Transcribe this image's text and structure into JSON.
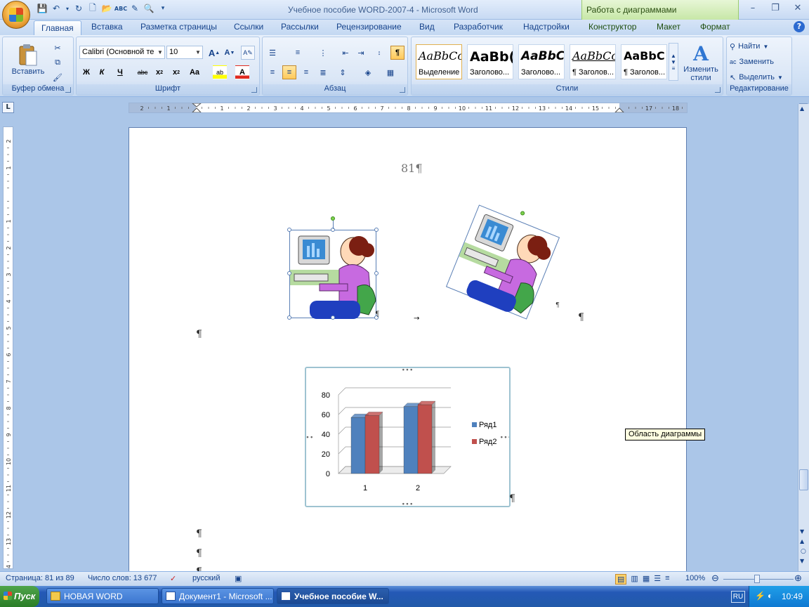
{
  "window": {
    "title": "Учебное пособие WORD-2007-4 - Microsoft Word",
    "contextual_group": "Работа с диаграммами",
    "minimize": "–",
    "maximize": "❐",
    "close": "✕"
  },
  "tabs": [
    {
      "label": "Главная",
      "active": true
    },
    {
      "label": "Вставка"
    },
    {
      "label": "Разметка страницы"
    },
    {
      "label": "Ссылки"
    },
    {
      "label": "Рассылки"
    },
    {
      "label": "Рецензирование"
    },
    {
      "label": "Вид"
    },
    {
      "label": "Разработчик"
    },
    {
      "label": "Надстройки"
    },
    {
      "label": "Конструктор"
    },
    {
      "label": "Макет"
    },
    {
      "label": "Формат"
    }
  ],
  "ribbon": {
    "clipboard": {
      "label": "Буфер обмена",
      "paste": "Вставить"
    },
    "font": {
      "label": "Шрифт",
      "font_name": "Calibri (Основной те",
      "font_size": "10"
    },
    "paragraph": {
      "label": "Абзац"
    },
    "styles": {
      "label": "Стили",
      "items": [
        {
          "sample": "AaBbCc",
          "name": "Выделение"
        },
        {
          "sample": "AaBb(",
          "name": "Заголово..."
        },
        {
          "sample": "AaBbC",
          "name": "Заголово..."
        },
        {
          "sample": "AaBbCc",
          "name": "¶ Заголов..."
        },
        {
          "sample": "AaBbC",
          "name": "¶ Заголов..."
        }
      ],
      "change_styles": "Изменить стили"
    },
    "editing": {
      "label": "Редактирование",
      "find": "Найти",
      "replace": "Заменить",
      "select": "Выделить"
    }
  },
  "ruler_numbers": [
    "2",
    "1",
    "",
    "1",
    "2",
    "3",
    "4",
    "5",
    "6",
    "7",
    "8",
    "9",
    "10",
    "11",
    "12",
    "13",
    "14",
    "15",
    "",
    "17",
    "18"
  ],
  "vruler_numbers": [
    "2",
    "1",
    "",
    "1",
    "2",
    "3",
    "4",
    "5",
    "6",
    "7",
    "8",
    "9",
    "10",
    "11",
    "12",
    "13",
    "14"
  ],
  "document": {
    "page_number": "81¶",
    "pilcrow": "¶"
  },
  "chart_data": {
    "type": "bar",
    "categories": [
      "1",
      "2"
    ],
    "series": [
      {
        "name": "Ряд1",
        "values": [
          57,
          68
        ],
        "color": "#4f81bd"
      },
      {
        "name": "Ряд2",
        "values": [
          59,
          70
        ],
        "color": "#c0504d"
      }
    ],
    "ylim": [
      0,
      80
    ],
    "yticks": [
      "80",
      "60",
      "40",
      "20",
      "0"
    ],
    "legend": "right",
    "grid": true
  },
  "tooltip": "Область диаграммы",
  "statusbar": {
    "page": "Страница: 81 из 89",
    "words": "Число слов: 13 677",
    "language": "русский",
    "zoom": "100%"
  },
  "taskbar": {
    "start": "Пуск",
    "tasks": [
      {
        "label": "НОВАЯ WORD"
      },
      {
        "label": "Документ1 - Microsoft ..."
      },
      {
        "label": "Учебное пособие W...",
        "active": true
      }
    ],
    "lang": "RU",
    "clock": "10:49"
  }
}
